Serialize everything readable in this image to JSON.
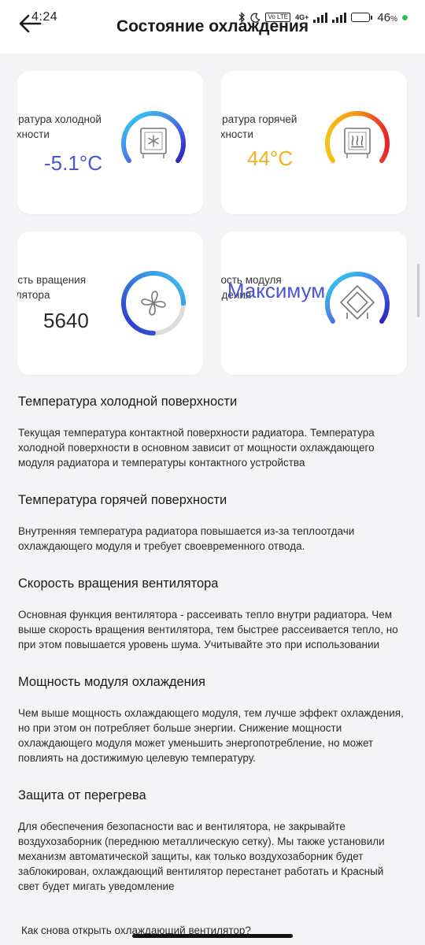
{
  "status": {
    "time": "4:24",
    "network": "4G+",
    "volte": "Vo LTE",
    "battery": "46",
    "battery_unit": "%",
    "battery_level": 0.46
  },
  "header": {
    "title": "Состояние охлаждения"
  },
  "cards": [
    {
      "label": "Температура холодной поверхности",
      "value": "-5.1°C",
      "value_color": "#4a55d6",
      "icon": "snowflake-icon"
    },
    {
      "label": "Температура горячей поверхности",
      "value": "44°C",
      "value_color": "#f2b21c",
      "icon": "heat-icon"
    },
    {
      "label": "Скорость вращения вентилятора",
      "value": "5640",
      "value_color": "#2a2a2a",
      "icon": "fan-icon",
      "fan_level": 0.75
    },
    {
      "label": "Мощность модуля охлаждения",
      "value": "Максимум",
      "value_color": "#4a55d6",
      "icon": "cooling-module-icon"
    }
  ],
  "sections": [
    {
      "title": "Температура холодной поверхности",
      "text": "Текущая температура контактной поверхности радиатора. Температура холодной поверхности в основном зависит от мощности охлаждающего модуля радиатора и температуры контактного устройства"
    },
    {
      "title": "Температура горячей поверхности",
      "text": "Внутренняя температура радиатора повышается из-за теплоотдачи охлаждающего модуля и требует своевременного отвода."
    },
    {
      "title": "Скорость вращения вентилятора",
      "text": "Основная функция вентилятора - рассеивать тепло внутри радиатора. Чем выше скорость вращения вентилятора, тем быстрее рассеивается тепло, но при этом повышается уровень шума. Учитывайте это при использовании"
    },
    {
      "title": "Мощность модуля охлаждения",
      "text": "Чем выше мощность охлаждающего модуля, тем лучше эффект охлаждения, но при этом он потребляет больше энергии. Снижение мощности охлаждающего модуля может уменьшить энергопотребление, но может повлиять на достижимую целевую температуру."
    },
    {
      "title": "Защита от перегрева",
      "text": "Для обеспечения безопасности вас и вентилятора, не закрывайте воздухозаборник (переднюю металлическую сетку). Мы также установили механизм автоматической защиты, как только воздухозаборник будет заблокирован, охлаждающий вентилятор перестанет работать и Красный свет будет мигать уведомление"
    }
  ],
  "footer_question": "Как снова открыть охлаждающий вентилятор?",
  "colors": {
    "accent": "#4a55d6",
    "warm": "#f2b21c",
    "card_bg": "#ffffff",
    "page_bg": "#f4f4f6"
  }
}
